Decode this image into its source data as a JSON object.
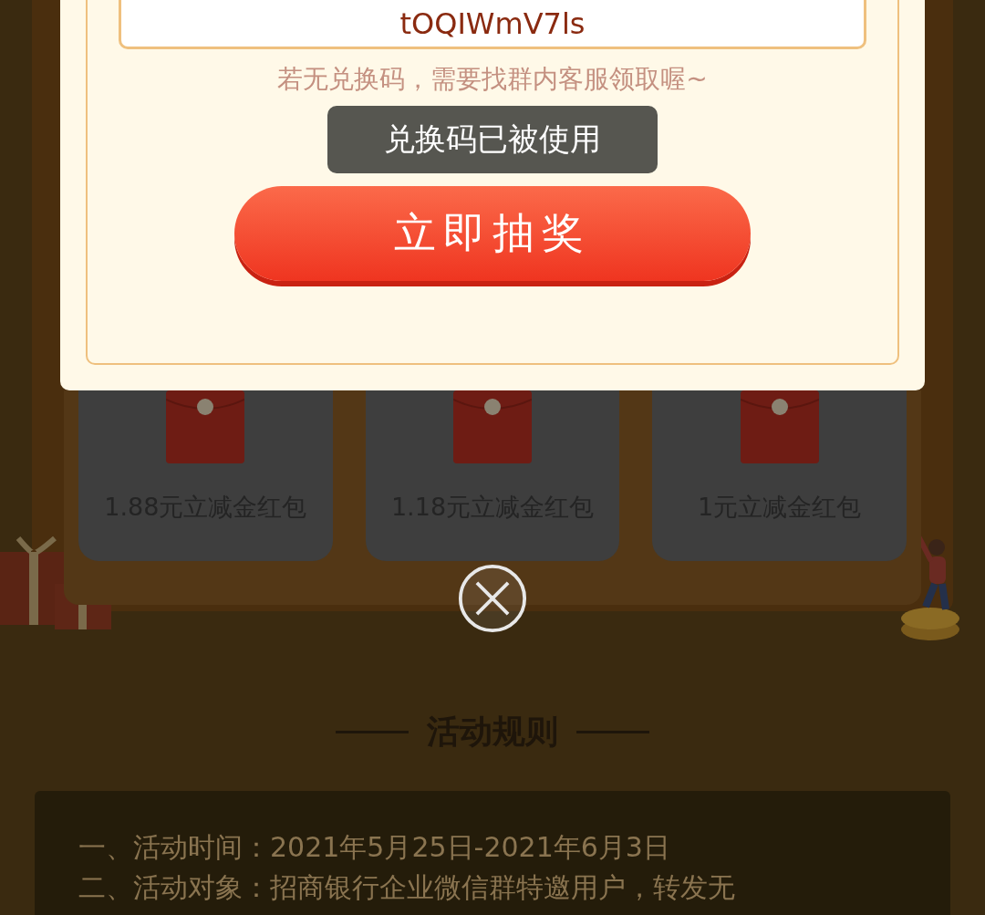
{
  "dialog": {
    "code_value": "tOQIWmV7ls",
    "hint": "若无兑换码，需要找群内客服领取喔~",
    "toast": "兑换码已被使用",
    "draw_button": "立即抽奖"
  },
  "prizes": [
    {
      "label": "1.88元立减金红包"
    },
    {
      "label": "1.18元立减金红包"
    },
    {
      "label": "1元立减金红包"
    }
  ],
  "rules": {
    "title": "活动规则",
    "items": [
      "一、活动时间：2021年5月25日-2021年6月3日",
      "二、活动对象：招商银行企业微信群特邀用户，转发无"
    ]
  }
}
